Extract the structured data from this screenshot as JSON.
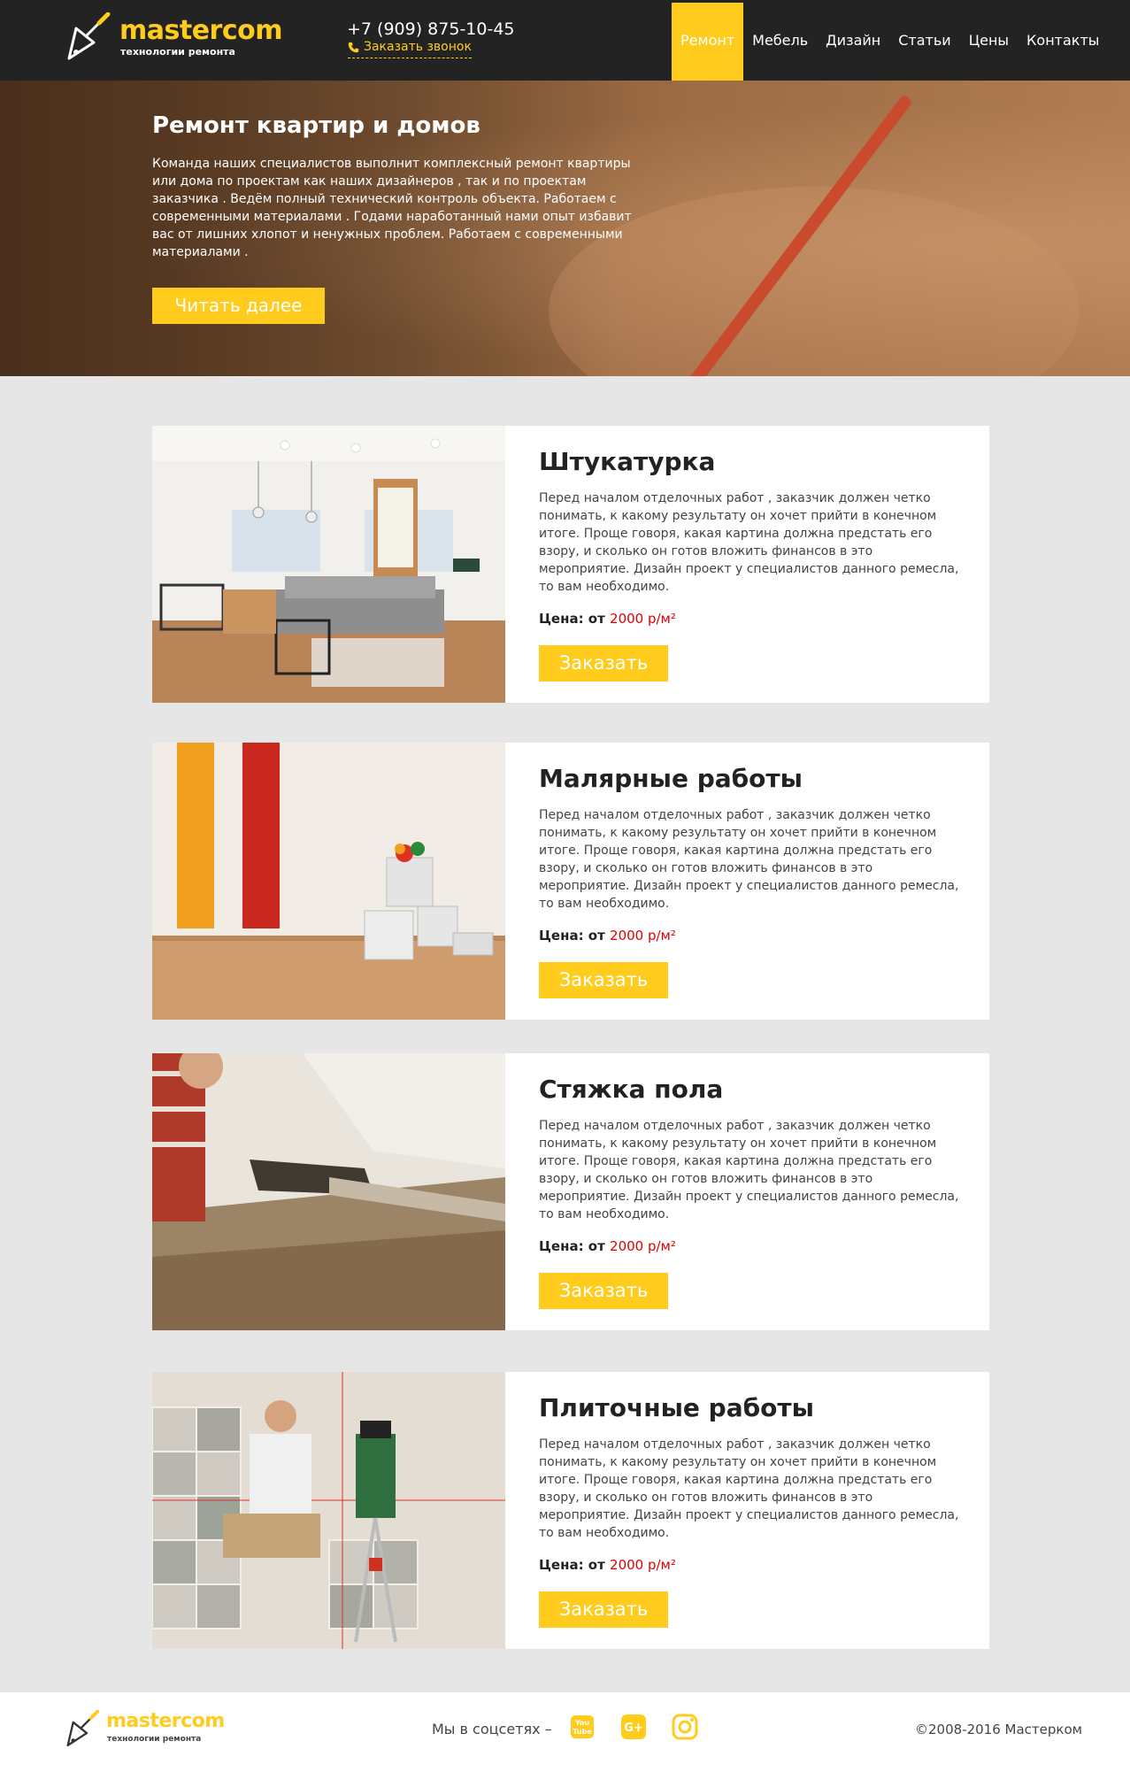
{
  "header": {
    "logo_title": "mastercom",
    "logo_subtitle": "технологии ремонта",
    "phone": "+7 (909) 875-10-45",
    "callback_label": "Заказать звонок",
    "nav": [
      {
        "label": "Ремонт",
        "active": true
      },
      {
        "label": "Мебель"
      },
      {
        "label": "Дизайн"
      },
      {
        "label": "Статьи"
      },
      {
        "label": "Цены"
      },
      {
        "label": "Контакты"
      }
    ]
  },
  "hero": {
    "title": "Ремонт квартир и домов",
    "text": "Команда наших специалистов выполнит комплексный ремонт квартиры или дома по проектам как наших дизайнеров , так и по проектам заказчика . Ведём полный технический контроль объекта.  Работаем с современными материалами . Годами наработанный нами опыт избавит вас от лишних хлопот и ненужных проблем. Работаем с современными материалами .",
    "button_label": "Читать далее"
  },
  "services": [
    {
      "title": "Штукатурка",
      "text": "Перед началом отделочных работ , заказчик должен четко понимать, к какому результату он хочет прийти в конечном итоге. Проще говоря, какая картина должна предстать его взору, и сколько он готов вложить финансов в это мероприятие.  Дизайн проект у специалистов данного ремесла, то вам необходимо.",
      "price_label": "Цена: от ",
      "price_value": "2000 р/м²",
      "button_label": "Заказать"
    },
    {
      "title": "Малярные работы",
      "text": "Перед началом отделочных работ , заказчик должен четко понимать, к какому результату он хочет прийти в конечном итоге. Проще говоря, какая картина должна предстать его взору, и сколько он готов вложить финансов в это мероприятие.  Дизайн проект у специалистов данного ремесла, то вам необходимо.",
      "price_label": "Цена: от ",
      "price_value": "2000 р/м²",
      "button_label": "Заказать"
    },
    {
      "title": "Стяжка пола",
      "text": "Перед началом отделочных работ , заказчик должен четко понимать, к какому результату он хочет прийти в конечном итоге. Проще говоря, какая картина должна предстать его взору, и сколько он готов вложить финансов в это мероприятие.  Дизайн проект у специалистов данного ремесла, то вам необходимо.",
      "price_label": "Цена: от ",
      "price_value": "2000 р/м²",
      "button_label": "Заказать"
    },
    {
      "title": "Плиточные работы",
      "text": "Перед началом отделочных работ , заказчик должен четко понимать, к какому результату он хочет прийти в конечном итоге. Проще говоря, какая картина должна предстать его взору, и сколько он готов вложить финансов в это мероприятие.  Дизайн проект у специалистов данного ремесла, то вам необходимо.",
      "price_label": "Цена: от ",
      "price_value": "2000 р/м²",
      "button_label": "Заказать"
    }
  ],
  "footer": {
    "logo_title": "mastercom",
    "logo_subtitle": "технологии ремонта",
    "social_label": "Мы в соцсетях –",
    "social_icons": [
      "youtube-icon",
      "google-plus-icon",
      "instagram-icon"
    ],
    "copyright": "©2008-2016 Мастерком"
  },
  "colors": {
    "accent": "#ffcc1d",
    "header_bg": "#232323",
    "page_bg": "#e6e6e6",
    "price": "#e00000"
  }
}
